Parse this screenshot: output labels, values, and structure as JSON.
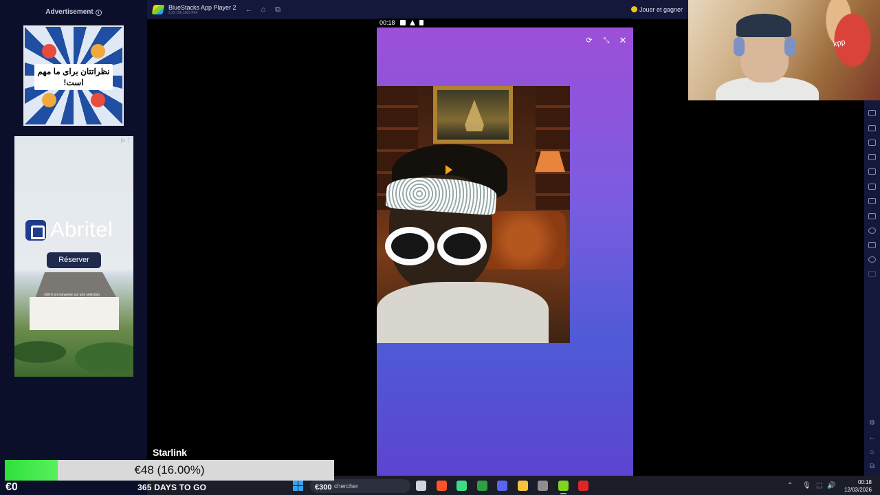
{
  "ad_panel": {
    "label": "Advertisement",
    "ad1_text": "نظراتتان برای ما مهم است!",
    "ad2": {
      "brand": "Abritel",
      "button": "Réserver",
      "note": "-100 € en moyenne sur une sélection d'hébergements.",
      "adchoices": "▷ ⋮"
    }
  },
  "bluestacks": {
    "title": "BlueStacks App Player 2",
    "version": "5.22.156.1003 P64",
    "reward_label": "Jouer et gagner",
    "icons": [
      "back-icon",
      "home-icon",
      "multi-instance-icon"
    ]
  },
  "phone": {
    "status_time": "00:18",
    "controls": [
      "refresh-icon",
      "minimize-icon",
      "close-icon"
    ]
  },
  "stream_overlay": {
    "goal_title": "Starlink",
    "progress_text": "€48 (16.00%)",
    "progress_fraction": 0.16,
    "start_value": "€0",
    "days_left": "365 DAYS TO GO",
    "search_overlay": "€300"
  },
  "webcam": {
    "caption": "kpp"
  },
  "taskbar": {
    "search_placeholder": "chercher",
    "time": "00:18",
    "date": "12/03/2026",
    "apps": [
      {
        "name": "taskview-icon",
        "color": "#cfd3dc"
      },
      {
        "name": "brave-icon",
        "color": "#fb542b"
      },
      {
        "name": "android-studio-icon",
        "color": "#3ddc84"
      },
      {
        "name": "terminal-icon",
        "color": "#2ea043"
      },
      {
        "name": "discord-icon",
        "color": "#5865f2"
      },
      {
        "name": "file-explorer-icon",
        "color": "#f5c33b"
      },
      {
        "name": "obs-icon",
        "color": "#8e8e8e"
      },
      {
        "name": "bluestacks-icon",
        "color": "#7fd321"
      },
      {
        "name": "media-player-icon",
        "color": "#e02525"
      }
    ]
  },
  "colors": {
    "progress_fill": "#2fe03a",
    "phone_gradient_top": "#9d4fd9",
    "phone_gradient_bottom": "#5d44d0",
    "bluestacks_chrome": "#14183a"
  }
}
